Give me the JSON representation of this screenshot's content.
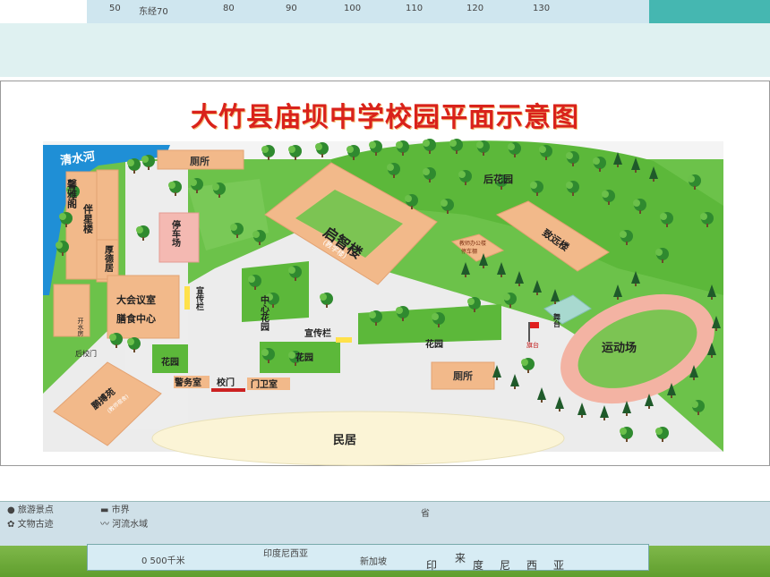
{
  "title": "大竹县庙坝中学校园平面示意图",
  "background": {
    "top_ticks": [
      "50",
      "东经70",
      "80",
      "90",
      "100",
      "110",
      "120",
      "130"
    ],
    "legend": [
      {
        "symbol": "●",
        "label": "旅游景点"
      },
      {
        "symbol": "✿",
        "label": "文物古迹"
      },
      {
        "symbol": "▬",
        "label": "市界"
      },
      {
        "symbol": "〰",
        "label": "河流水域"
      }
    ],
    "bottom_labels": [
      "省",
      "印度尼西亚",
      "新加坡",
      "印",
      "度",
      "尼",
      "西",
      "亚",
      "来"
    ],
    "scale_label": "0      500千米"
  },
  "labels": {
    "river": "清水河",
    "toilet_top": "厕所",
    "teaching_building": "启智楼",
    "teaching_building_sub": "(教学楼)",
    "back_garden": "后花园",
    "zhiyuan_building": "致远楼",
    "office_building": "教师办公楼",
    "office_building_sub": "停车棚",
    "dorm_1": "馨雅阁",
    "dorm_2": "伴星楼",
    "houde": "厚德居",
    "parking": "停车场",
    "meeting": "大会议室",
    "canteen": "膳食中心",
    "bulletin_1": "宣传栏",
    "central_garden": "中心花园",
    "bulletin_2": "宣传栏",
    "garden_small": "花园",
    "garden_mid": "花园",
    "garden_right": "花园",
    "stage": "舞台",
    "flag": "旗台",
    "playground": "运动场",
    "toilet_bottom": "厕所",
    "water_room": "开水房",
    "back_gate": "后校门",
    "pengbo": "鹏搏苑",
    "pengbo_sub": "(教师宿舍)",
    "guard": "警务室",
    "gate": "校门",
    "doorman": "门卫室",
    "residence": "民居"
  },
  "colors": {
    "grass": "#5cb83a",
    "building": "#f2b98a",
    "river": "#1f8fd6",
    "title": "#d9221b",
    "track": "#f3b3a3",
    "road": "#ececec"
  }
}
